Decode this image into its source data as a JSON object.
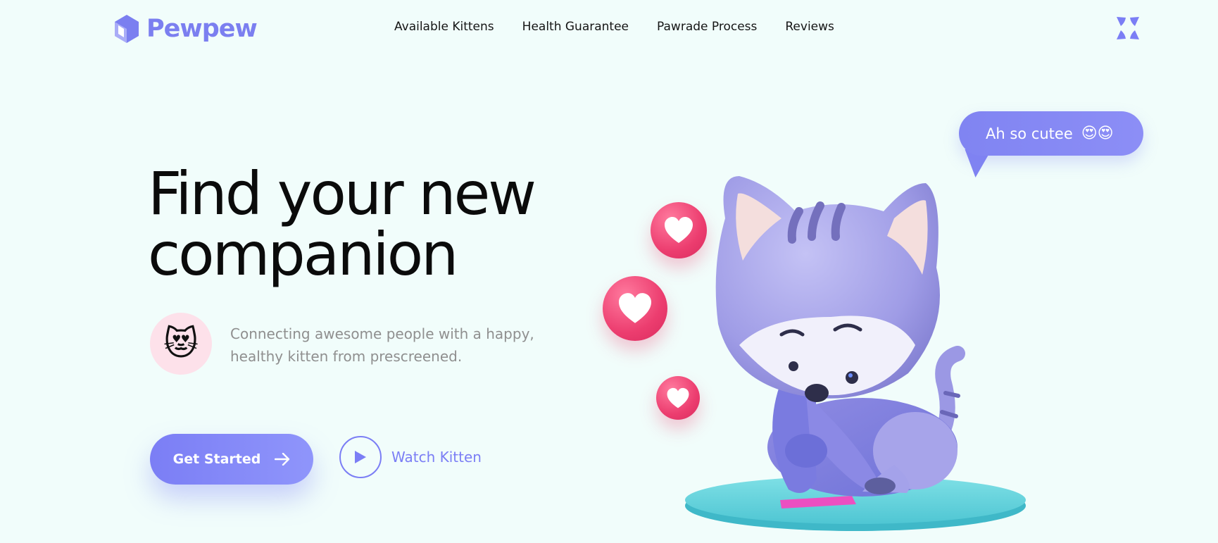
{
  "brand": {
    "name": "Pewpew",
    "color": "#7b7ff0"
  },
  "nav": {
    "items": [
      {
        "label": "Available Kittens"
      },
      {
        "label": "Health Guarantee"
      },
      {
        "label": "Pawrade Process"
      },
      {
        "label": "Reviews"
      }
    ]
  },
  "hero": {
    "headline_line1": "Find your new",
    "headline_line2": "companion",
    "badge_emoji": "😻",
    "subtitle": "Connecting awesome people with a happy, healthy kitten from prescreened.",
    "primary_button_label": "Get Started",
    "secondary_button_label": "Watch Kitten"
  },
  "illustration": {
    "speech_bubble_text": "Ah so cutee",
    "speech_bubble_emoji": "😍😍",
    "heart_count": 3,
    "accent_color": "#7b7ef5",
    "heart_color": "#ec3d6f"
  },
  "icons": {
    "logo": "cube-logo-icon",
    "menu": "four-petal-menu-icon",
    "play": "play-icon",
    "arrow": "arrow-right-icon",
    "heart": "heart-icon"
  }
}
